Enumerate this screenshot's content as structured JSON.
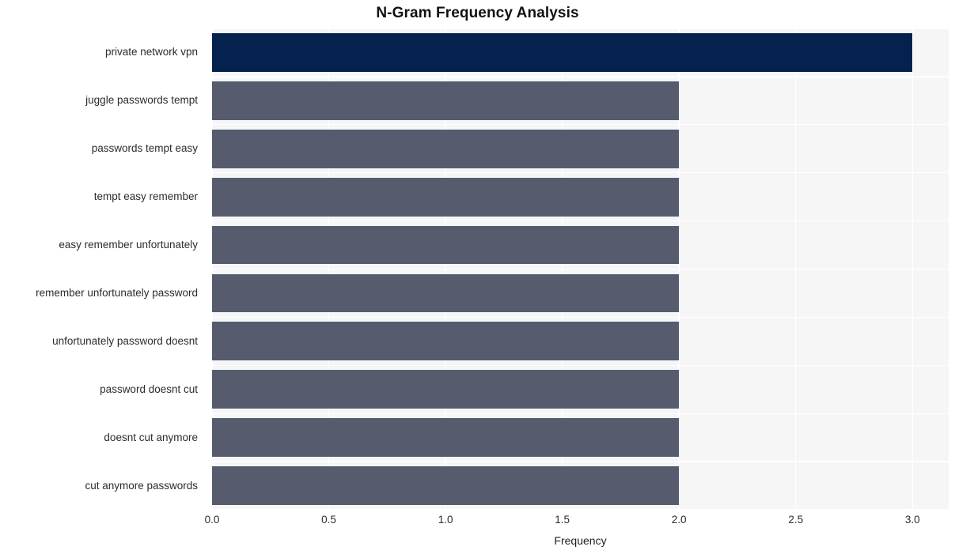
{
  "chart_data": {
    "type": "bar",
    "orientation": "horizontal",
    "title": "N-Gram Frequency Analysis",
    "xlabel": "Frequency",
    "ylabel": "",
    "categories": [
      "private network vpn",
      "juggle passwords tempt",
      "passwords tempt easy",
      "tempt easy remember",
      "easy remember unfortunately",
      "remember unfortunately password",
      "unfortunately password doesnt",
      "password doesnt cut",
      "doesnt cut anymore",
      "cut anymore passwords"
    ],
    "values": [
      3,
      2,
      2,
      2,
      2,
      2,
      2,
      2,
      2,
      2
    ],
    "bar_colors": [
      "#04224d",
      "#565c6e",
      "#565c6e",
      "#565c6e",
      "#565c6e",
      "#565c6e",
      "#565c6e",
      "#565c6e",
      "#565c6e",
      "#565c6e"
    ],
    "xlim": [
      0,
      3.155
    ],
    "xticks": [
      0.0,
      0.5,
      1.0,
      1.5,
      2.0,
      2.5,
      3.0
    ],
    "xticklabels": [
      "0.0",
      "0.5",
      "1.0",
      "1.5",
      "2.0",
      "2.5",
      "3.0"
    ],
    "grid": true,
    "grid_color": "#ffffff",
    "plot_background": "#f6f6f7",
    "figure_background": "#ffffff",
    "legend": null,
    "legend_position": "none"
  }
}
